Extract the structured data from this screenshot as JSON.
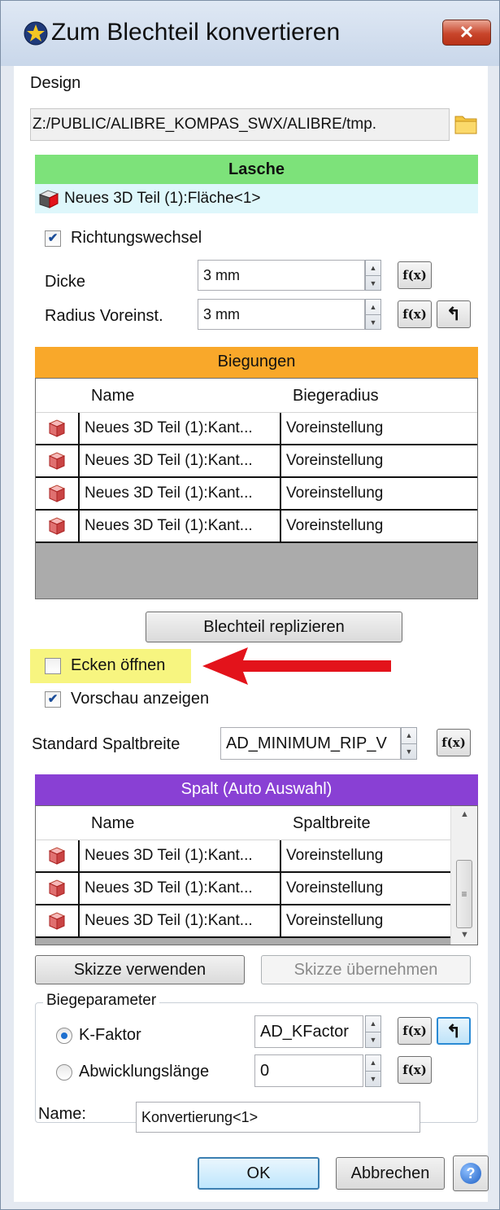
{
  "window": {
    "title": "Zum Blechteil konvertieren",
    "close_label": "✕"
  },
  "design": {
    "label": "Design",
    "path": "Z:/PUBLIC/ALIBRE_KOMPAS_SWX/ALIBRE/tmp."
  },
  "lasche": {
    "header": "Lasche",
    "selection": "Neues 3D Teil (1):Fläche<1>"
  },
  "richtungswechsel": {
    "label": "Richtungswechsel",
    "checked": true
  },
  "dicke": {
    "label": "Dicke",
    "value": "3 mm",
    "fx": "f(x)"
  },
  "radius": {
    "label": "Radius Voreinst.",
    "value": "3 mm",
    "fx": "f(x)",
    "reset": "↰"
  },
  "biegungen": {
    "header": "Biegungen",
    "columns": [
      "Name",
      "Biegeradius"
    ],
    "rows": [
      [
        "Neues 3D Teil (1):Kant...",
        "Voreinstellung"
      ],
      [
        "Neues 3D Teil (1):Kant...",
        "Voreinstellung"
      ],
      [
        "Neues 3D Teil (1):Kant...",
        "Voreinstellung"
      ],
      [
        "Neues 3D Teil (1):Kant...",
        "Voreinstellung"
      ]
    ]
  },
  "replicate_button": "Blechteil replizieren",
  "ecken": {
    "label": "Ecken öffnen",
    "checked": false,
    "highlight": "#f7f580",
    "arrow_color": "#e3131b"
  },
  "vorschau": {
    "label": "Vorschau anzeigen",
    "checked": true
  },
  "spaltbreite": {
    "label": "Standard Spaltbreite",
    "value": "AD_MINIMUM_RIP_V",
    "fx": "f(x)"
  },
  "spalt": {
    "header": "Spalt (Auto Auswahl)",
    "columns": [
      "Name",
      "Spaltbreite"
    ],
    "rows": [
      [
        "Neues 3D Teil (1):Kant...",
        "Voreinstellung"
      ],
      [
        "Neues 3D Teil (1):Kant...",
        "Voreinstellung"
      ],
      [
        "Neues 3D Teil (1):Kant...",
        "Voreinstellung"
      ]
    ]
  },
  "skizze_verwenden": "Skizze verwenden",
  "skizze_uebernehmen": "Skizze übernehmen",
  "biegeparameter": {
    "legend": "Biegeparameter",
    "kfaktor": {
      "label": "K-Faktor",
      "selected": true,
      "value": "AD_KFactor",
      "fx": "f(x)",
      "reset": "↰"
    },
    "abwicklung": {
      "label": "Abwicklungslänge",
      "selected": false,
      "value": "0",
      "fx": "f(x)"
    }
  },
  "name": {
    "label": "Name:",
    "value": "Konvertierung<1>"
  },
  "buttons": {
    "ok": "OK",
    "cancel": "Abbrechen",
    "help": "?"
  },
  "colors": {
    "lasche_header": "#7de27a",
    "lasche_selection_bg": "#def7fb",
    "biegungen_header": "#f9a82a",
    "spalt_header": "#8940d4"
  }
}
